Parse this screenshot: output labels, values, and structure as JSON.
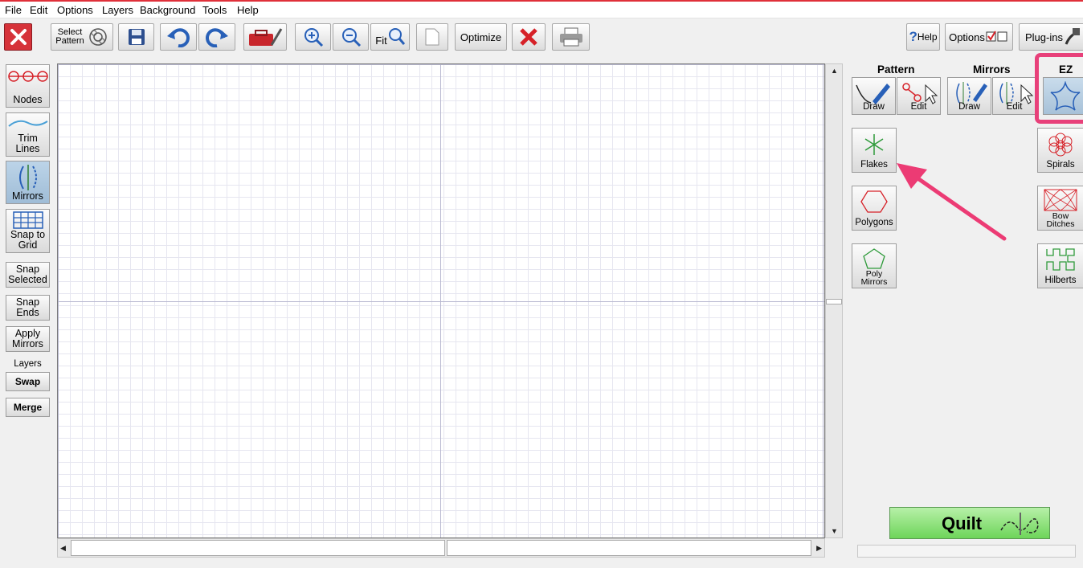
{
  "menu": [
    "File",
    "Edit",
    "Options",
    "Layers",
    "Background",
    "Tools",
    "Help"
  ],
  "toolbar": {
    "select_pattern_line1": "Select",
    "select_pattern_line2": "Pattern",
    "fit": "Fit",
    "optimize": "Optimize",
    "help": "Help",
    "options": "Options",
    "plugins": "Plug-ins"
  },
  "left_tools": {
    "nodes": "Nodes",
    "trim_line1": "Trim",
    "trim_line2": "Lines",
    "mirrors": "Mirrors",
    "snap_grid_line1": "Snap to",
    "snap_grid_line2": "Grid",
    "snap_selected_line1": "Snap",
    "snap_selected_line2": "Selected",
    "snap_ends_line1": "Snap",
    "snap_ends_line2": "Ends",
    "apply_mirrors_line1": "Apply",
    "apply_mirrors_line2": "Mirrors",
    "layers_label": "Layers",
    "swap": "Swap",
    "merge": "Merge"
  },
  "right_panel": {
    "pattern_header": "Pattern",
    "mirrors_header": "Mirrors",
    "ez_header": "EZ",
    "draw": "Draw",
    "edit": "Edit",
    "flakes": "Flakes",
    "polygons": "Polygons",
    "poly_mirrors_line1": "Poly",
    "poly_mirrors_line2": "Mirrors",
    "spirals": "Spirals",
    "bow_ditches_line1": "Bow",
    "bow_ditches_line2": "Ditches",
    "hilberts": "Hilberts"
  },
  "quilt_label": "Quilt",
  "colors": {
    "accent_highlight": "#e8407a",
    "quilt_green": "#6ed55a",
    "active_tool": "#9fbcd6"
  }
}
